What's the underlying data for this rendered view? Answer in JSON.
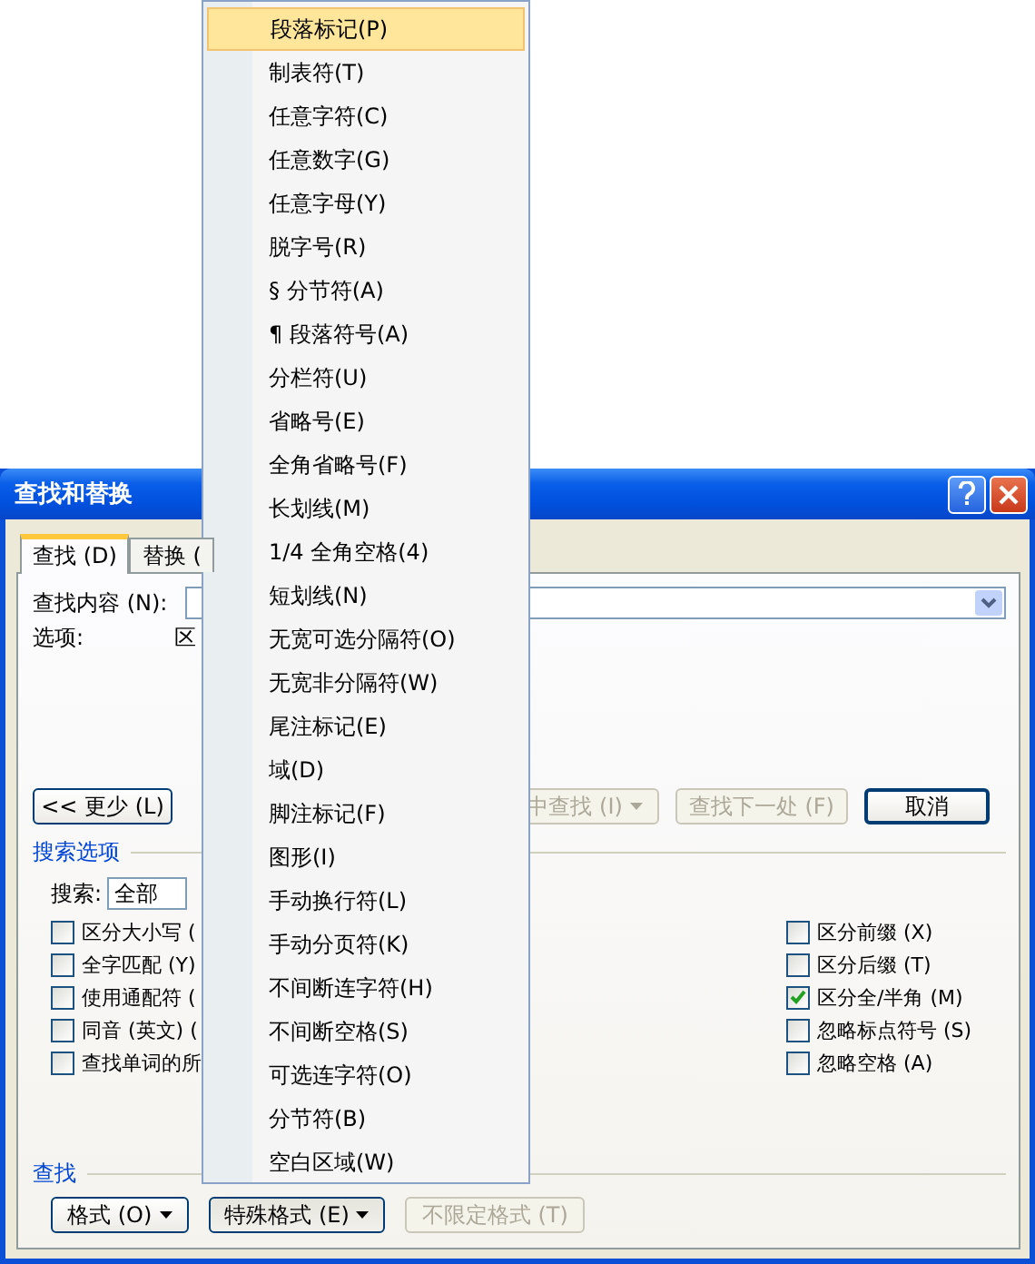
{
  "dialog": {
    "title": "查找和替换",
    "tabs": [
      {
        "label": "查找 (D)",
        "selected": true
      },
      {
        "label": "替换 (",
        "selected": false
      }
    ],
    "find_label": "查找内容 (N):",
    "options_label": "选项:",
    "options_value": "区",
    "buttons": [
      {
        "label": "<< 更少 (L)",
        "disabled": false,
        "caret": false,
        "default": false
      },
      {
        "label": "中查找 (I)",
        "disabled": true,
        "caret": true,
        "default": false
      },
      {
        "label": "查找下一处 (F)",
        "disabled": true,
        "caret": false,
        "default": false
      },
      {
        "label": "取消",
        "disabled": false,
        "caret": false,
        "default": true
      }
    ],
    "search_options": {
      "title": "搜索选项",
      "search_label": "搜索:",
      "search_value": "全部",
      "left_checks": [
        {
          "label": "区分大小写 (",
          "checked": false
        },
        {
          "label": "全字匹配 (Y)",
          "checked": false
        },
        {
          "label": "使用通配符 (",
          "checked": false
        },
        {
          "label": "同音 (英文) (",
          "checked": false
        },
        {
          "label": "查找单词的所",
          "checked": false
        }
      ],
      "right_checks": [
        {
          "label": "区分前缀 (X)",
          "checked": false
        },
        {
          "label": "区分后缀 (T)",
          "checked": false
        },
        {
          "label": "区分全/半角 (M)",
          "checked": true
        },
        {
          "label": "忽略标点符号 (S)",
          "checked": false
        },
        {
          "label": "忽略空格 (A)",
          "checked": false
        }
      ]
    },
    "find_section": {
      "title": "查找",
      "buttons": [
        {
          "label": "格式 (O)",
          "caret": true,
          "disabled": false,
          "pressed": false
        },
        {
          "label": "特殊格式 (E)",
          "caret": true,
          "disabled": false,
          "pressed": true
        },
        {
          "label": "不限定格式 (T)",
          "caret": false,
          "disabled": true,
          "pressed": false
        }
      ]
    }
  },
  "menu": {
    "items": [
      {
        "label": "段落标记(P)",
        "selected": true
      },
      {
        "label": "制表符(T)",
        "selected": false
      },
      {
        "label": "任意字符(C)",
        "selected": false
      },
      {
        "label": "任意数字(G)",
        "selected": false
      },
      {
        "label": "任意字母(Y)",
        "selected": false
      },
      {
        "label": "脱字号(R)",
        "selected": false
      },
      {
        "label": "§ 分节符(A)",
        "selected": false
      },
      {
        "label": "¶ 段落符号(A)",
        "selected": false
      },
      {
        "label": "分栏符(U)",
        "selected": false
      },
      {
        "label": "省略号(E)",
        "selected": false
      },
      {
        "label": "全角省略号(F)",
        "selected": false
      },
      {
        "label": "长划线(M)",
        "selected": false
      },
      {
        "label": "1/4 全角空格(4)",
        "selected": false
      },
      {
        "label": "短划线(N)",
        "selected": false
      },
      {
        "label": "无宽可选分隔符(O)",
        "selected": false
      },
      {
        "label": "无宽非分隔符(W)",
        "selected": false
      },
      {
        "label": "尾注标记(E)",
        "selected": false
      },
      {
        "label": "域(D)",
        "selected": false
      },
      {
        "label": "脚注标记(F)",
        "selected": false
      },
      {
        "label": "图形(I)",
        "selected": false
      },
      {
        "label": "手动换行符(L)",
        "selected": false
      },
      {
        "label": "手动分页符(K)",
        "selected": false
      },
      {
        "label": "不间断连字符(H)",
        "selected": false
      },
      {
        "label": "不间断空格(S)",
        "selected": false
      },
      {
        "label": "可选连字符(O)",
        "selected": false
      },
      {
        "label": "分节符(B)",
        "selected": false
      },
      {
        "label": "空白区域(W)",
        "selected": false
      }
    ]
  }
}
